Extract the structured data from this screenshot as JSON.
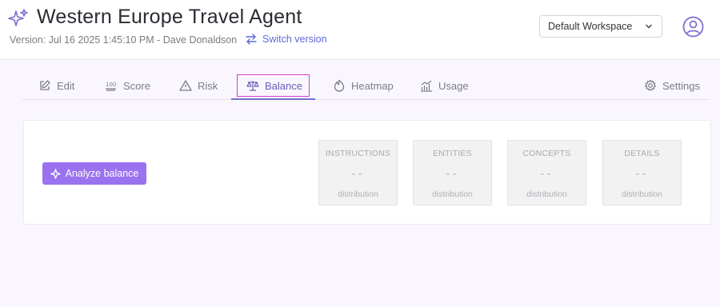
{
  "header": {
    "title": "Western Europe Travel Agent",
    "version": "Version: Jul 16 2025 1:45:10 PM - Dave Donaldson",
    "switch_version": "Switch version",
    "workspace": "Default Workspace"
  },
  "tabs": [
    {
      "label": "Edit",
      "icon": "edit-icon"
    },
    {
      "label": "Score",
      "icon": "score-100-icon"
    },
    {
      "label": "Risk",
      "icon": "warning-icon"
    },
    {
      "label": "Balance",
      "icon": "scale-icon"
    },
    {
      "label": "Heatmap",
      "icon": "heatmap-icon"
    },
    {
      "label": "Usage",
      "icon": "usage-chart-icon"
    },
    {
      "label": "Settings",
      "icon": "gear-icon"
    }
  ],
  "active_tab": "Balance",
  "panel": {
    "analyze_button": "Analyze balance",
    "metrics": [
      {
        "title": "INSTRUCTIONS",
        "value": "--",
        "sub": "distribution"
      },
      {
        "title": "ENTITIES",
        "value": "--",
        "sub": "distribution"
      },
      {
        "title": "CONCEPTS",
        "value": "--",
        "sub": "distribution"
      },
      {
        "title": "DETAILS",
        "value": "--",
        "sub": "distribution"
      }
    ]
  },
  "colors": {
    "accent": "#9a72f0",
    "link": "#5e6bd8",
    "focus_outline": "#d63ccf"
  }
}
